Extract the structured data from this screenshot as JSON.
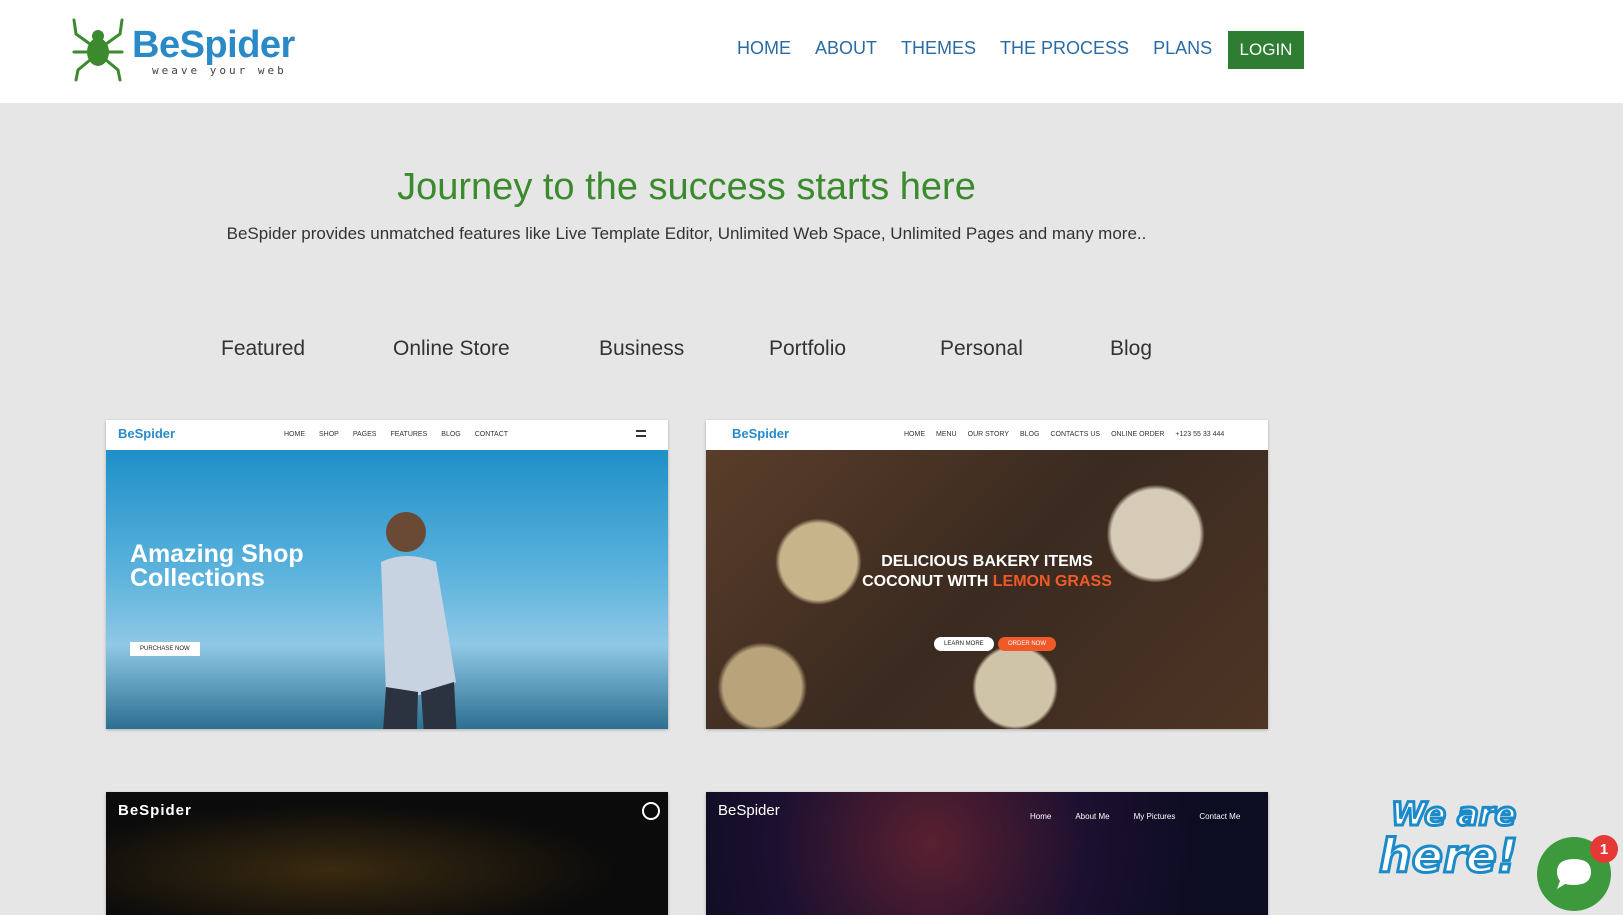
{
  "header": {
    "logo_text": "BeSpider",
    "logo_tagline": "weave your web",
    "nav": [
      {
        "label": "HOME"
      },
      {
        "label": "ABOUT"
      },
      {
        "label": "THEMES"
      },
      {
        "label": "THE PROCESS"
      },
      {
        "label": "PLANS"
      }
    ],
    "login_label": "LOGIN"
  },
  "hero": {
    "title": "Journey to the success starts here",
    "subtitle": "BeSpider provides unmatched features like Live Template Editor, Unlimited Web Space, Unlimited Pages and many more.."
  },
  "categories": [
    "Featured",
    "Online Store",
    "Business",
    "Portfolio",
    "Personal",
    "Blog"
  ],
  "cards": [
    {
      "logo": "BeSpider",
      "nav": [
        "HOME",
        "SHOP",
        "PAGES",
        "FEATURES",
        "BLOG",
        "CONTACT"
      ],
      "title_line1": "Amazing Shop",
      "title_line2": "Collections",
      "button": "PURCHASE NOW"
    },
    {
      "logo": "BeSpider",
      "nav": [
        "HOME",
        "MENU",
        "OUR STORY",
        "BLOG",
        "CONTACTS US",
        "ONLINE ORDER",
        "+123 55 33 444"
      ],
      "title_line1": "DELICIOUS BAKERY ITEMS",
      "title_line2a": "COCONUT WITH ",
      "title_line2b": "LEMON GRASS",
      "btn1": "LEARN MORE",
      "btn2": "ORDER NOW"
    },
    {
      "logo": "BeSpider"
    },
    {
      "logo": "BeSpider",
      "nav": [
        "Home",
        "About Me",
        "My Pictures",
        "Contact Me"
      ]
    }
  ],
  "chat": {
    "badge_text_1": "We are",
    "badge_text_2": "here!",
    "notification_count": "1"
  },
  "colors": {
    "brand_blue": "#2a8ac8",
    "brand_green": "#3b8a2e",
    "login_green": "#2e7d32",
    "nav_blue": "#2a6aa6"
  }
}
